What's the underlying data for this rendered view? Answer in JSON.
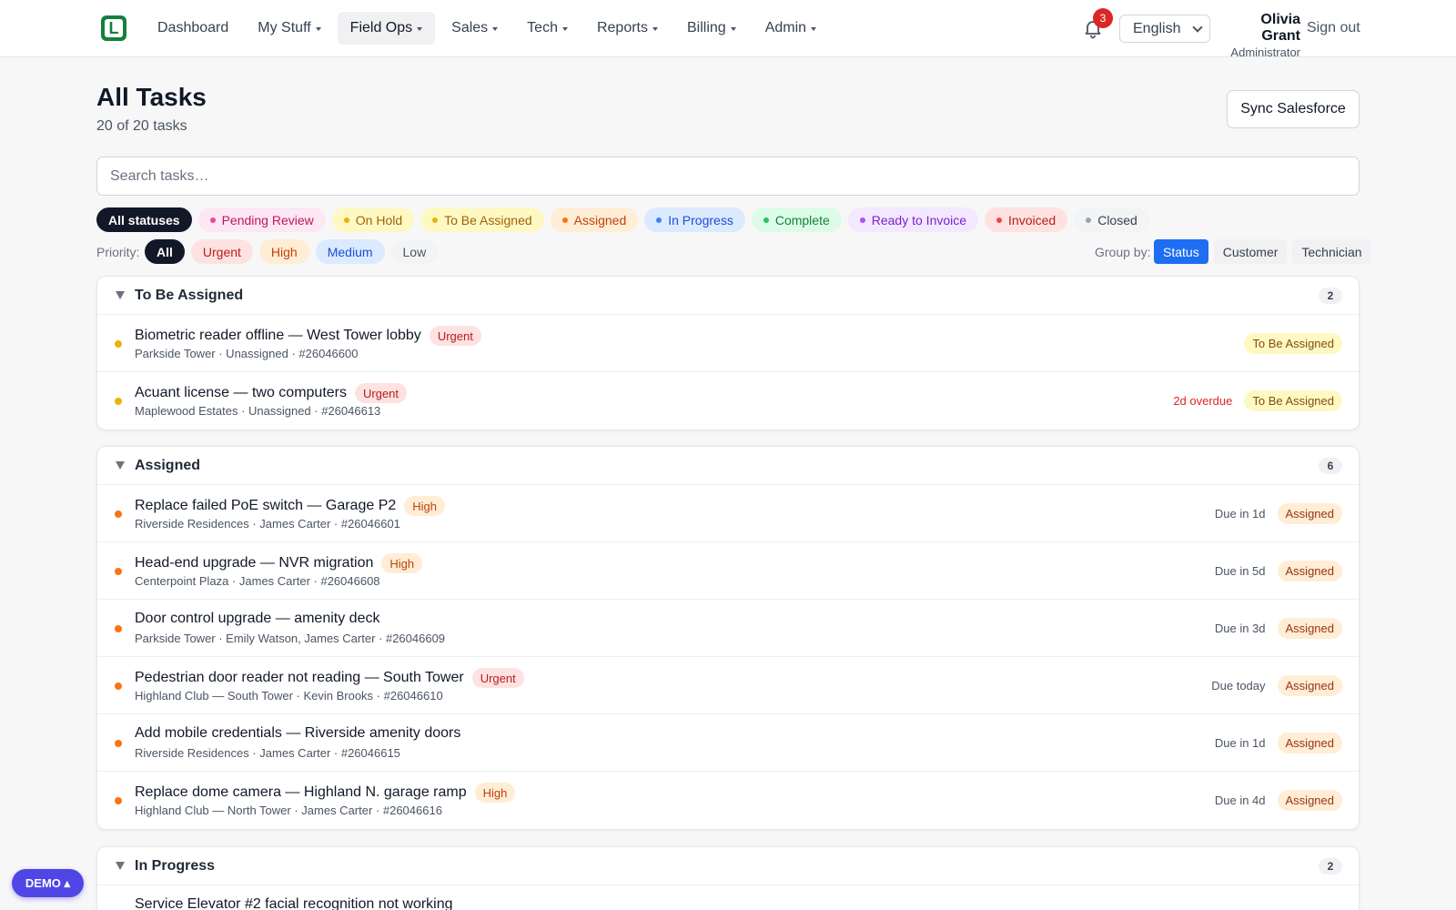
{
  "nav": {
    "logo_letter": "L",
    "items": [
      {
        "label": "Dashboard",
        "caret": false,
        "active": false
      },
      {
        "label": "My Stuff",
        "caret": true,
        "active": false
      },
      {
        "label": "Field Ops",
        "caret": true,
        "active": true
      },
      {
        "label": "Sales",
        "caret": true,
        "active": false
      },
      {
        "label": "Tech",
        "caret": true,
        "active": false
      },
      {
        "label": "Reports",
        "caret": true,
        "active": false
      },
      {
        "label": "Billing",
        "caret": true,
        "active": false
      },
      {
        "label": "Admin",
        "caret": true,
        "active": false
      }
    ],
    "notification_count": "3",
    "language": "English",
    "user_name": "Olivia Grant",
    "user_role": "Administrator",
    "sign_out": "Sign out"
  },
  "header": {
    "title": "All Tasks",
    "subtitle": "20 of 20 tasks",
    "sync_label": "Sync Salesforce",
    "search_placeholder": "Search tasks…"
  },
  "status_filters": [
    {
      "label": "All statuses",
      "active": true,
      "dot": "",
      "bg": "#111827",
      "fg": "#ffffff"
    },
    {
      "label": "Pending Review",
      "active": false,
      "dot": "#ec4899",
      "bg": "#fce7f3",
      "fg": "#be185d"
    },
    {
      "label": "On Hold",
      "active": false,
      "dot": "#eab308",
      "bg": "#fef9c3",
      "fg": "#a16207"
    },
    {
      "label": "To Be Assigned",
      "active": false,
      "dot": "#eab308",
      "bg": "#fef9c3",
      "fg": "#a16207"
    },
    {
      "label": "Assigned",
      "active": false,
      "dot": "#f97316",
      "bg": "#ffedd5",
      "fg": "#c2410c"
    },
    {
      "label": "In Progress",
      "active": false,
      "dot": "#3b82f6",
      "bg": "#dbeafe",
      "fg": "#1d4ed8"
    },
    {
      "label": "Complete",
      "active": false,
      "dot": "#22c55e",
      "bg": "#dcfce7",
      "fg": "#15803d"
    },
    {
      "label": "Ready to Invoice",
      "active": false,
      "dot": "#a855f7",
      "bg": "#f3e8ff",
      "fg": "#7e22ce"
    },
    {
      "label": "Invoiced",
      "active": false,
      "dot": "#ef4444",
      "bg": "#fee2e2",
      "fg": "#b91c1c"
    },
    {
      "label": "Closed",
      "active": false,
      "dot": "#9ca3af",
      "bg": "#f3f4f6",
      "fg": "#374151"
    }
  ],
  "priority": {
    "label": "Priority:",
    "options": [
      {
        "label": "All",
        "active": true,
        "bg": "#111827",
        "fg": "#ffffff"
      },
      {
        "label": "Urgent",
        "active": false,
        "bg": "#fee2e2",
        "fg": "#b91c1c"
      },
      {
        "label": "High",
        "active": false,
        "bg": "#ffedd5",
        "fg": "#c2410c"
      },
      {
        "label": "Medium",
        "active": false,
        "bg": "#dbeafe",
        "fg": "#1d4ed8"
      },
      {
        "label": "Low",
        "active": false,
        "bg": "#f3f4f6",
        "fg": "#4b5563"
      }
    ]
  },
  "group_by": {
    "label": "Group by:",
    "options": [
      {
        "label": "Status",
        "active": true
      },
      {
        "label": "Customer",
        "active": false
      },
      {
        "label": "Technician",
        "active": false
      }
    ]
  },
  "priority_styles": {
    "Urgent": {
      "bg": "#fee2e2",
      "fg": "#b91c1c"
    },
    "High": {
      "bg": "#ffedd5",
      "fg": "#c2410c"
    }
  },
  "groups": [
    {
      "title": "To Be Assigned",
      "count": "2",
      "dot": "#eab308",
      "tag_bg": "#fef9c3",
      "tag_fg": "#854d0e",
      "tasks": [
        {
          "title": "Biometric reader offline — West Tower lobby",
          "priority": "Urgent",
          "meta": "Parkside Tower · Unassigned · #26046600",
          "due": "",
          "overdue": false,
          "status": "To Be Assigned"
        },
        {
          "title": "Acuant license — two computers",
          "priority": "Urgent",
          "meta": "Maplewood Estates · Unassigned · #26046613",
          "due": "2d overdue",
          "overdue": true,
          "status": "To Be Assigned"
        }
      ]
    },
    {
      "title": "Assigned",
      "count": "6",
      "dot": "#f97316",
      "tag_bg": "#ffedd5",
      "tag_fg": "#9a3412",
      "tasks": [
        {
          "title": "Replace failed PoE switch — Garage P2",
          "priority": "High",
          "meta": "Riverside Residences · James Carter · #26046601",
          "due": "Due in 1d",
          "overdue": false,
          "status": "Assigned"
        },
        {
          "title": "Head-end upgrade — NVR migration",
          "priority": "High",
          "meta": "Centerpoint Plaza · James Carter · #26046608",
          "due": "Due in 5d",
          "overdue": false,
          "status": "Assigned"
        },
        {
          "title": "Door control upgrade — amenity deck",
          "priority": "",
          "meta": "Parkside Tower · Emily Watson, James Carter · #26046609",
          "due": "Due in 3d",
          "overdue": false,
          "status": "Assigned"
        },
        {
          "title": "Pedestrian door reader not reading — South Tower",
          "priority": "Urgent",
          "meta": "Highland Club — South Tower · Kevin Brooks · #26046610",
          "due": "Due today",
          "overdue": false,
          "status": "Assigned"
        },
        {
          "title": "Add mobile credentials — Riverside amenity doors",
          "priority": "",
          "meta": "Riverside Residences · James Carter · #26046615",
          "due": "Due in 1d",
          "overdue": false,
          "status": "Assigned"
        },
        {
          "title": "Replace dome camera — Highland N. garage ramp",
          "priority": "High",
          "meta": "Highland Club — North Tower · James Carter · #26046616",
          "due": "Due in 4d",
          "overdue": false,
          "status": "Assigned"
        }
      ]
    },
    {
      "title": "In Progress",
      "count": "2",
      "dot": "#3b82f6",
      "tag_bg": "#dbeafe",
      "tag_fg": "#1d4ed8",
      "tasks": [
        {
          "title": "Service Elevator #2 facial recognition not working",
          "priority": "",
          "meta": "",
          "due": "",
          "overdue": false,
          "status": ""
        }
      ]
    }
  ],
  "demo_label": "DEMO ▴"
}
